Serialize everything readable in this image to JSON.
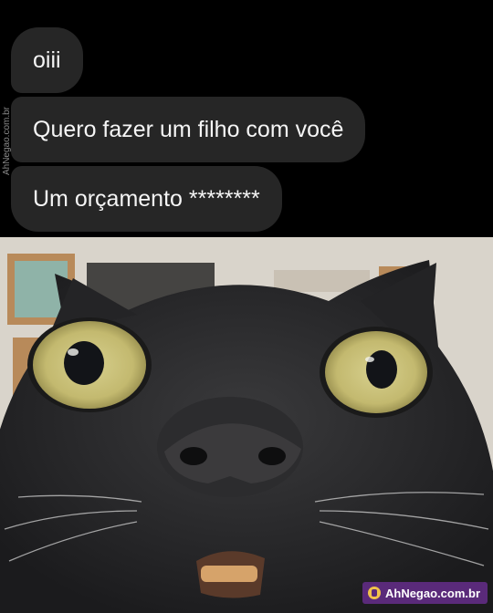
{
  "messages": [
    {
      "text": "oiii"
    },
    {
      "text": "Quero fazer um filho com você"
    },
    {
      "text": "Um orçamento ********"
    }
  ],
  "watermark": {
    "side_text": "AhNegao.com.br",
    "badge_text": "AhNegao.com.br"
  },
  "photo": {
    "icon": "surprised-cat-photo"
  },
  "colors": {
    "chat_background": "#000000",
    "bubble": "#262626",
    "bubble_text": "#f5f5f5",
    "badge": "#5a2a7a"
  }
}
